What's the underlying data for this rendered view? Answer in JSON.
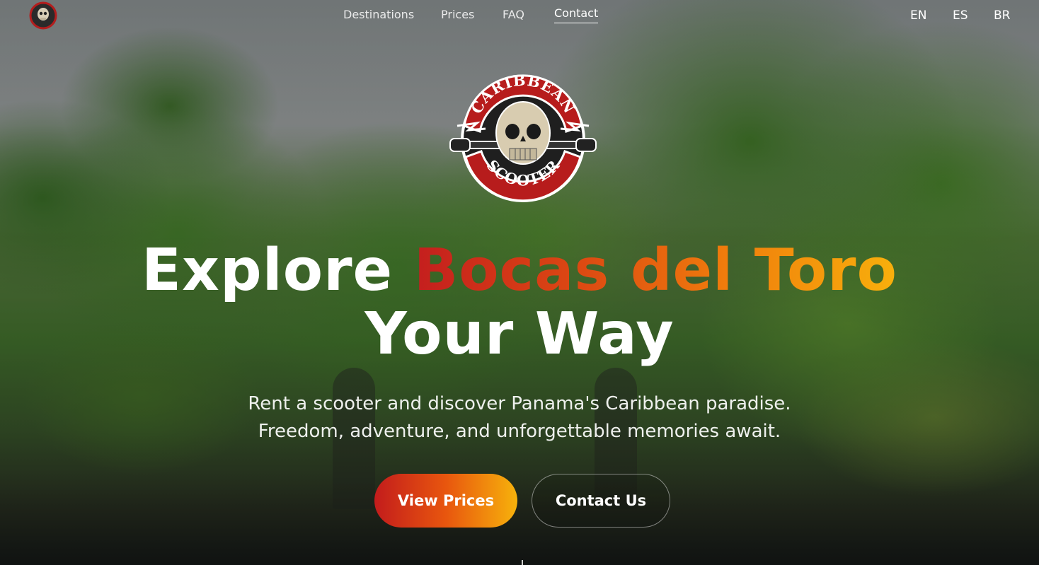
{
  "nav": {
    "links": [
      "Destinations",
      "Prices",
      "FAQ",
      "Contact"
    ],
    "active": "Contact",
    "languages": [
      "EN",
      "ES",
      "BR"
    ]
  },
  "brand": {
    "logo_text_top": "CARIBBEAN",
    "logo_text_bottom": "SCOOTER",
    "colors": {
      "red": "#c41e1e",
      "orange": "#f07d0c",
      "yellow": "#f8b00c"
    }
  },
  "hero": {
    "headline_plain": "Explore",
    "headline_highlight": "Bocas del Toro",
    "headline_line2": "Your Way",
    "subtitle_line1": "Rent a scooter and discover Panama's Caribbean paradise.",
    "subtitle_line2": "Freedom, adventure, and unforgettable memories await.",
    "primary_button": "View Prices",
    "secondary_button": "Contact Us"
  },
  "icons": [
    "skull-logo-icon"
  ]
}
